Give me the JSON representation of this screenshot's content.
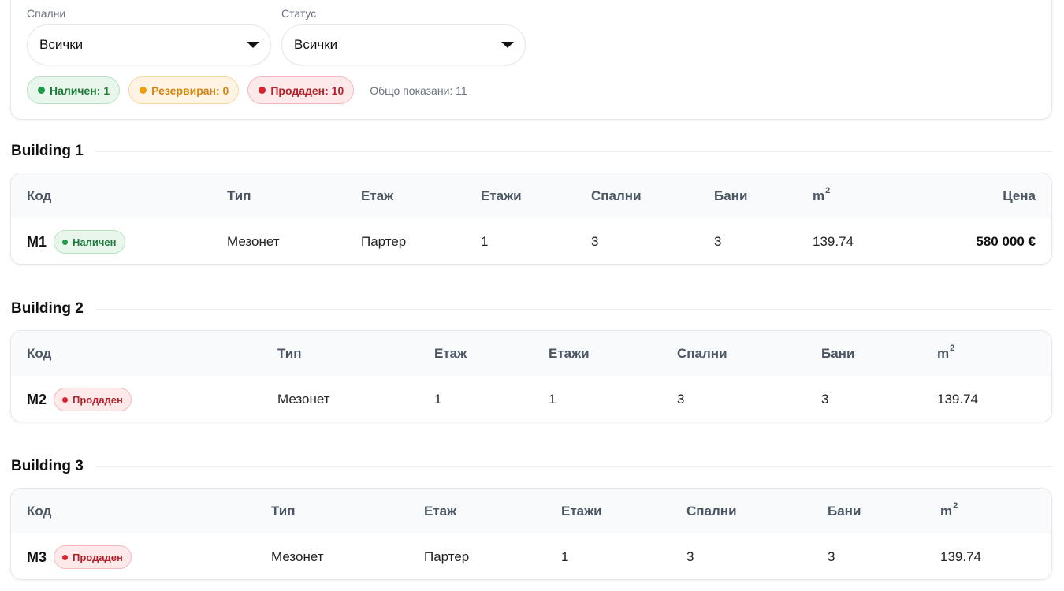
{
  "filters": {
    "bedrooms": {
      "label": "Спални",
      "value": "Всички"
    },
    "status": {
      "label": "Статус",
      "value": "Всички"
    }
  },
  "badges": {
    "available": "Наличен: 1",
    "reserved": "Резервиран: 0",
    "sold": "Продаден: 10",
    "total": "Общо показани: 11"
  },
  "colors": {
    "available": "#1e9a46",
    "reserved": "#f29b12",
    "sold": "#d8232e"
  },
  "columns": {
    "code": "Код",
    "type": "Тип",
    "floor": "Етаж",
    "floors": "Етажи",
    "bedrooms": "Спални",
    "baths": "Бани",
    "area": "m",
    "area_sup": "2",
    "price": "Цена"
  },
  "buildings": [
    {
      "title": "Building 1",
      "row": {
        "code": "M1",
        "status": "Наличен",
        "type": "Мезонет",
        "floor": "Партер",
        "floors": "1",
        "bedrooms": "3",
        "baths": "3",
        "area": "139.74",
        "price": "580 000 €"
      }
    },
    {
      "title": "Building 2",
      "row": {
        "code": "M2",
        "status": "Продаден",
        "type": "Мезонет",
        "floor": "1",
        "floors": "1",
        "bedrooms": "3",
        "baths": "3",
        "area": "139.74"
      }
    },
    {
      "title": "Building 3",
      "row": {
        "code": "M3",
        "status": "Продаден",
        "type": "Мезонет",
        "floor": "Партер",
        "floors": "1",
        "bedrooms": "3",
        "baths": "3",
        "area": "139.74"
      }
    }
  ]
}
